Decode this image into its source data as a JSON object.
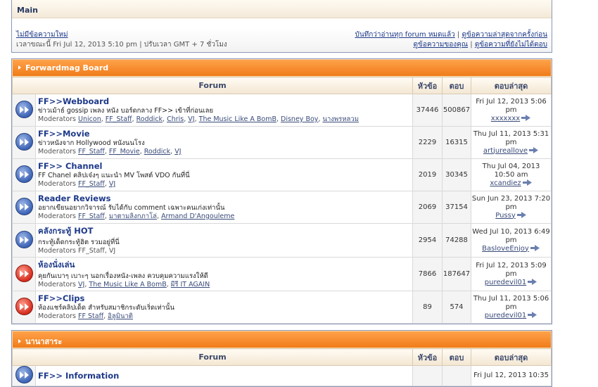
{
  "header": {
    "main_label": "Main",
    "search_new": "ไม่มีข้อความใหม่",
    "time_info": "เวลาขณะนี้ Fri Jul 12, 2013 5:10 pm | ปรับเวลา GMT + 7 ชั่วโมง",
    "mark_read": "บันทึกว่าอ่านทุก forum หมดแล้ว",
    "since_last": "ดูข้อความล่าสุดจากครั้งก่อน",
    "your_posts": "ดูข้อความของคุณ",
    "unanswered": "ดูข้อความที่ยังไม่ได้ตอบ",
    "separator": "|"
  },
  "columns": {
    "forum": "Forum",
    "topics": "หัวข้อ",
    "posts": "ตอบ",
    "last_post": "ตอบล่าสุด"
  },
  "categories": [
    {
      "title": "Forwardmag Board",
      "forums": [
        {
          "name": "FF>>Webboard",
          "desc": "ข่าวเม้าธ์ gossip เพลง หนัง บอร์ดกลาง FF>> เข้าที่ก่อนเลย",
          "mods_label": "Moderators",
          "mods": [
            "Unicon",
            "FF_Staff",
            "Roddick",
            "Chris",
            "VJ",
            "The Music Like A BomB",
            "Disney Boy",
            "นางพรหลวม"
          ],
          "topics": "37446",
          "posts": "500867",
          "last_date": "Fri Jul 12, 2013 5:06 pm",
          "last_user": "xxxxxxx",
          "icon": "blue"
        },
        {
          "name": "FF>>Movie",
          "desc": "ข่าวหนังจาก Hollywood หนังนนโรง",
          "mods_label": "Moderators",
          "mods": [
            "FF_Staff",
            "FF_Movie",
            "Roddick",
            "VJ"
          ],
          "topics": "2229",
          "posts": "16315",
          "last_date": "Thu Jul 11, 2013 5:31 pm",
          "last_user": "artjureallove",
          "icon": "blue"
        },
        {
          "name": "FF>> Channel",
          "desc": "FF Chanel คลิปเจ๋งๆ แนะนำ MV โพสต์ VDO กันที่นี่",
          "mods_label": "Moderators",
          "mods": [
            "FF_Staff",
            "VJ"
          ],
          "topics": "2019",
          "posts": "30345",
          "last_date": "Thu Jul 04, 2013 10:50 am",
          "last_user": "xcandiez",
          "icon": "blue"
        },
        {
          "name": "Reader Reviews",
          "desc": "อยากเขียนอยากวิจารณ์ รับได้กับ comment เฉพาะคนเก่งเท่านั้น",
          "mods_label": "Moderators",
          "mods": [
            "FF_Staff",
            "มาตามลิงกภาโล่",
            "Armand D'Angouleme"
          ],
          "topics": "2069",
          "posts": "37154",
          "last_date": "Sun Jun 23, 2013 7:20 pm",
          "last_user": "Pussy",
          "icon": "blue"
        },
        {
          "name": "คลังกระทู้ HOT",
          "desc": "กระทู้เด็ดกระทู้ฮิต รวมอยู่ที่นี่",
          "mods_label": "Moderators",
          "mods_plain": "FF_Staff, VJ",
          "topics": "2954",
          "posts": "74288",
          "last_date": "Wed Jul 10, 2013 6:49 pm",
          "last_user": "BasloveEnjoy",
          "icon": "blue"
        },
        {
          "name": "ห้องนั่งเล่น",
          "desc": "คุยกันเบาๆ เบาะๆ นอกเรื่องหนัง-เพลง ควบคุมความแรงให้ดี",
          "mods_label": "Moderators",
          "mods": [
            "VJ",
            "The Music Like A BomB",
            "ผีรี IT AGAIN"
          ],
          "topics": "7866",
          "posts": "187647",
          "last_date": "Fri Jul 12, 2013 5:09 pm",
          "last_user": "puredevil01",
          "icon": "red"
        },
        {
          "name": "FF>>Clips",
          "desc": "ห้องแชร์คลิปเด็ด สำหรับสมาชิกระดับเริ่ดเท่านั้น",
          "mods_label": "Moderators",
          "mods": [
            "FF Staff",
            "อิลูมินาติ"
          ],
          "topics": "89",
          "posts": "574",
          "last_date": "Thu Jul 11, 2013 5:06 pm",
          "last_user": "puredevil01",
          "icon": "red"
        }
      ]
    },
    {
      "title": "นานาสาระ",
      "forums": [
        {
          "name": "FF>> Information",
          "last_date": "Fri Jul 12, 2013 10:35",
          "icon": "blue"
        }
      ]
    }
  ]
}
